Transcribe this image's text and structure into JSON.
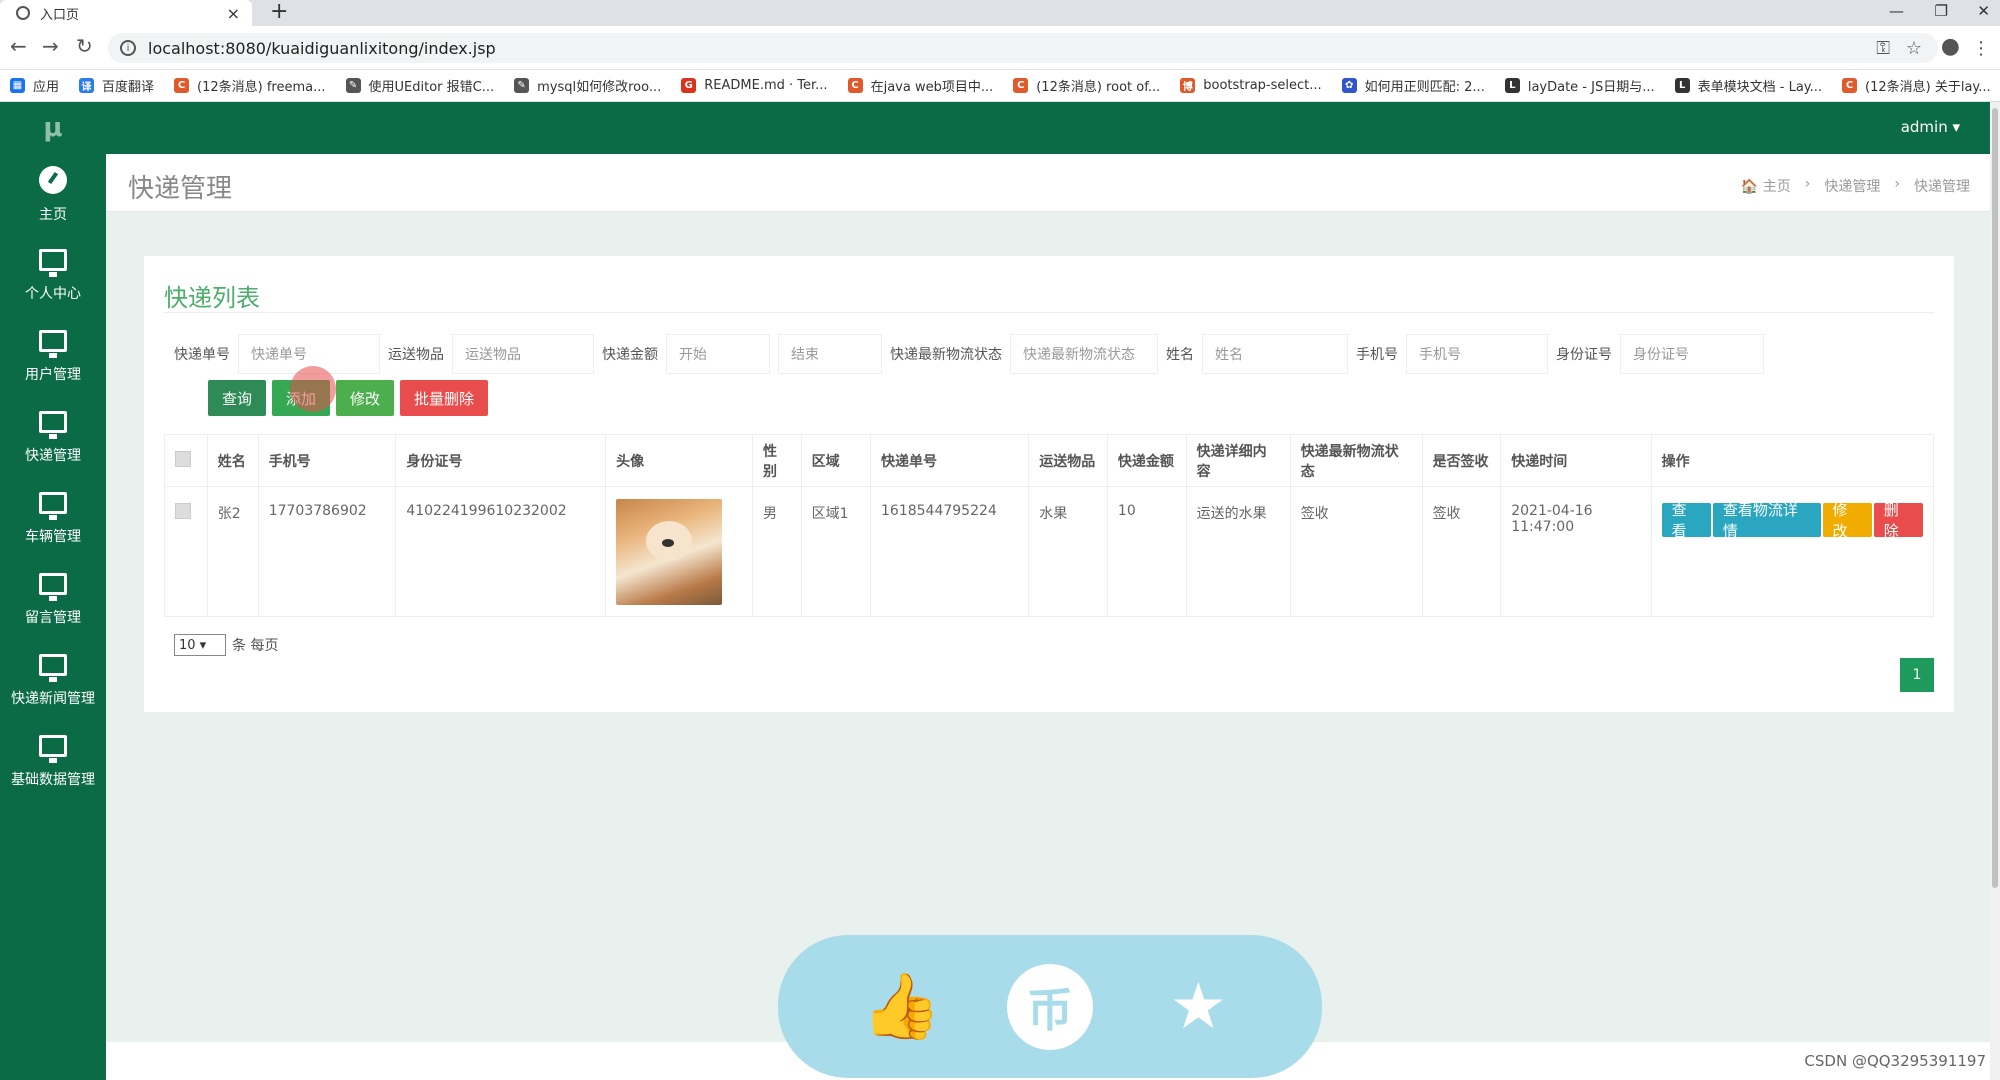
{
  "browser": {
    "tab_title": "入口页",
    "url": "localhost:8080/kuaidiguanlixitong/index.jsp",
    "bookmarks": [
      {
        "label": "应用",
        "color": "#1a73e8",
        "glyph": "▦"
      },
      {
        "label": "百度翻译",
        "color": "#2b7de9",
        "glyph": "译"
      },
      {
        "label": "(12条消息) freema...",
        "color": "#e05a2b",
        "glyph": "C"
      },
      {
        "label": "使用UEditor 报错C...",
        "color": "#555555",
        "glyph": "✎"
      },
      {
        "label": "mysql如何修改roo...",
        "color": "#555555",
        "glyph": "✎"
      },
      {
        "label": "README.md · Ter...",
        "color": "#d9341e",
        "glyph": "G"
      },
      {
        "label": "在java web项目中...",
        "color": "#e05a2b",
        "glyph": "C"
      },
      {
        "label": "(12条消息) root of...",
        "color": "#e05a2b",
        "glyph": "C"
      },
      {
        "label": "bootstrap-select...",
        "color": "#e05a2b",
        "glyph": "博"
      },
      {
        "label": "如何用正则匹配: 2...",
        "color": "#3355cc",
        "glyph": "✿"
      },
      {
        "label": "layDate - JS日期与...",
        "color": "#333333",
        "glyph": "L"
      },
      {
        "label": "表单模块文档 - Lay...",
        "color": "#333333",
        "glyph": "L"
      },
      {
        "label": "(12条消息) 关于lay...",
        "color": "#e05a2b",
        "glyph": "C"
      }
    ]
  },
  "app": {
    "logo": "μ",
    "user": "admin ▾",
    "sidebar": [
      {
        "label": "主页",
        "icon": "dashboard-icon"
      },
      {
        "label": "个人中心",
        "icon": "monitor-icon"
      },
      {
        "label": "用户管理",
        "icon": "monitor-icon"
      },
      {
        "label": "快递管理",
        "icon": "monitor-icon"
      },
      {
        "label": "车辆管理",
        "icon": "monitor-icon"
      },
      {
        "label": "留言管理",
        "icon": "monitor-icon"
      },
      {
        "label": "快递新闻管理",
        "icon": "monitor-icon"
      },
      {
        "label": "基础数据管理",
        "icon": "monitor-icon"
      }
    ],
    "page_title": "快递管理",
    "breadcrumb": [
      "🏠 主页",
      "›",
      "快递管理",
      "›",
      "快递管理"
    ]
  },
  "list": {
    "title": "快递列表",
    "filters": [
      {
        "label": "快递单号",
        "placeholder": "快递单号",
        "width": 142
      },
      {
        "label": "运送物品",
        "placeholder": "运送物品",
        "width": 142
      },
      {
        "label": "快递金额",
        "placeholder": "开始",
        "width": 104
      },
      {
        "label": "",
        "placeholder": "结束",
        "width": 104
      },
      {
        "label": "快递最新物流状态",
        "placeholder": "快递最新物流状态",
        "width": 148
      },
      {
        "label": "姓名",
        "placeholder": "姓名",
        "width": 146
      },
      {
        "label": "手机号",
        "placeholder": "手机号",
        "width": 142
      },
      {
        "label": "身份证号",
        "placeholder": "身份证号",
        "width": 144
      }
    ],
    "buttons": {
      "query": "查询",
      "add": "添加",
      "edit": "修改",
      "batch_delete": "批量删除"
    },
    "columns": [
      "",
      "姓名",
      "手机号",
      "身份证号",
      "头像",
      "性别",
      "区域",
      "快递单号",
      "运送物品",
      "快递金额",
      "快递详细内容",
      "快递最新物流状态",
      "是否签收",
      "快递时间",
      "操作"
    ],
    "rows": [
      {
        "name": "张2",
        "phone": "17703786902",
        "id_card": "410224199610232002",
        "gender": "男",
        "region": "区域1",
        "tracking_no": "1618544795224",
        "goods": "水果",
        "amount": "10",
        "detail": "运送的水果",
        "status": "签收",
        "signed": "签收",
        "time": "2021-04-16 11:47:00"
      }
    ],
    "row_actions": {
      "view": "查看",
      "logistics": "查看物流详情",
      "edit": "修改",
      "delete": "删除"
    },
    "per_page_value": "10",
    "per_page_suffix": "条 每页",
    "page": "1"
  },
  "overlay": {
    "coin_glyph": "币"
  },
  "watermark": "CSDN @QQ3295391197"
}
